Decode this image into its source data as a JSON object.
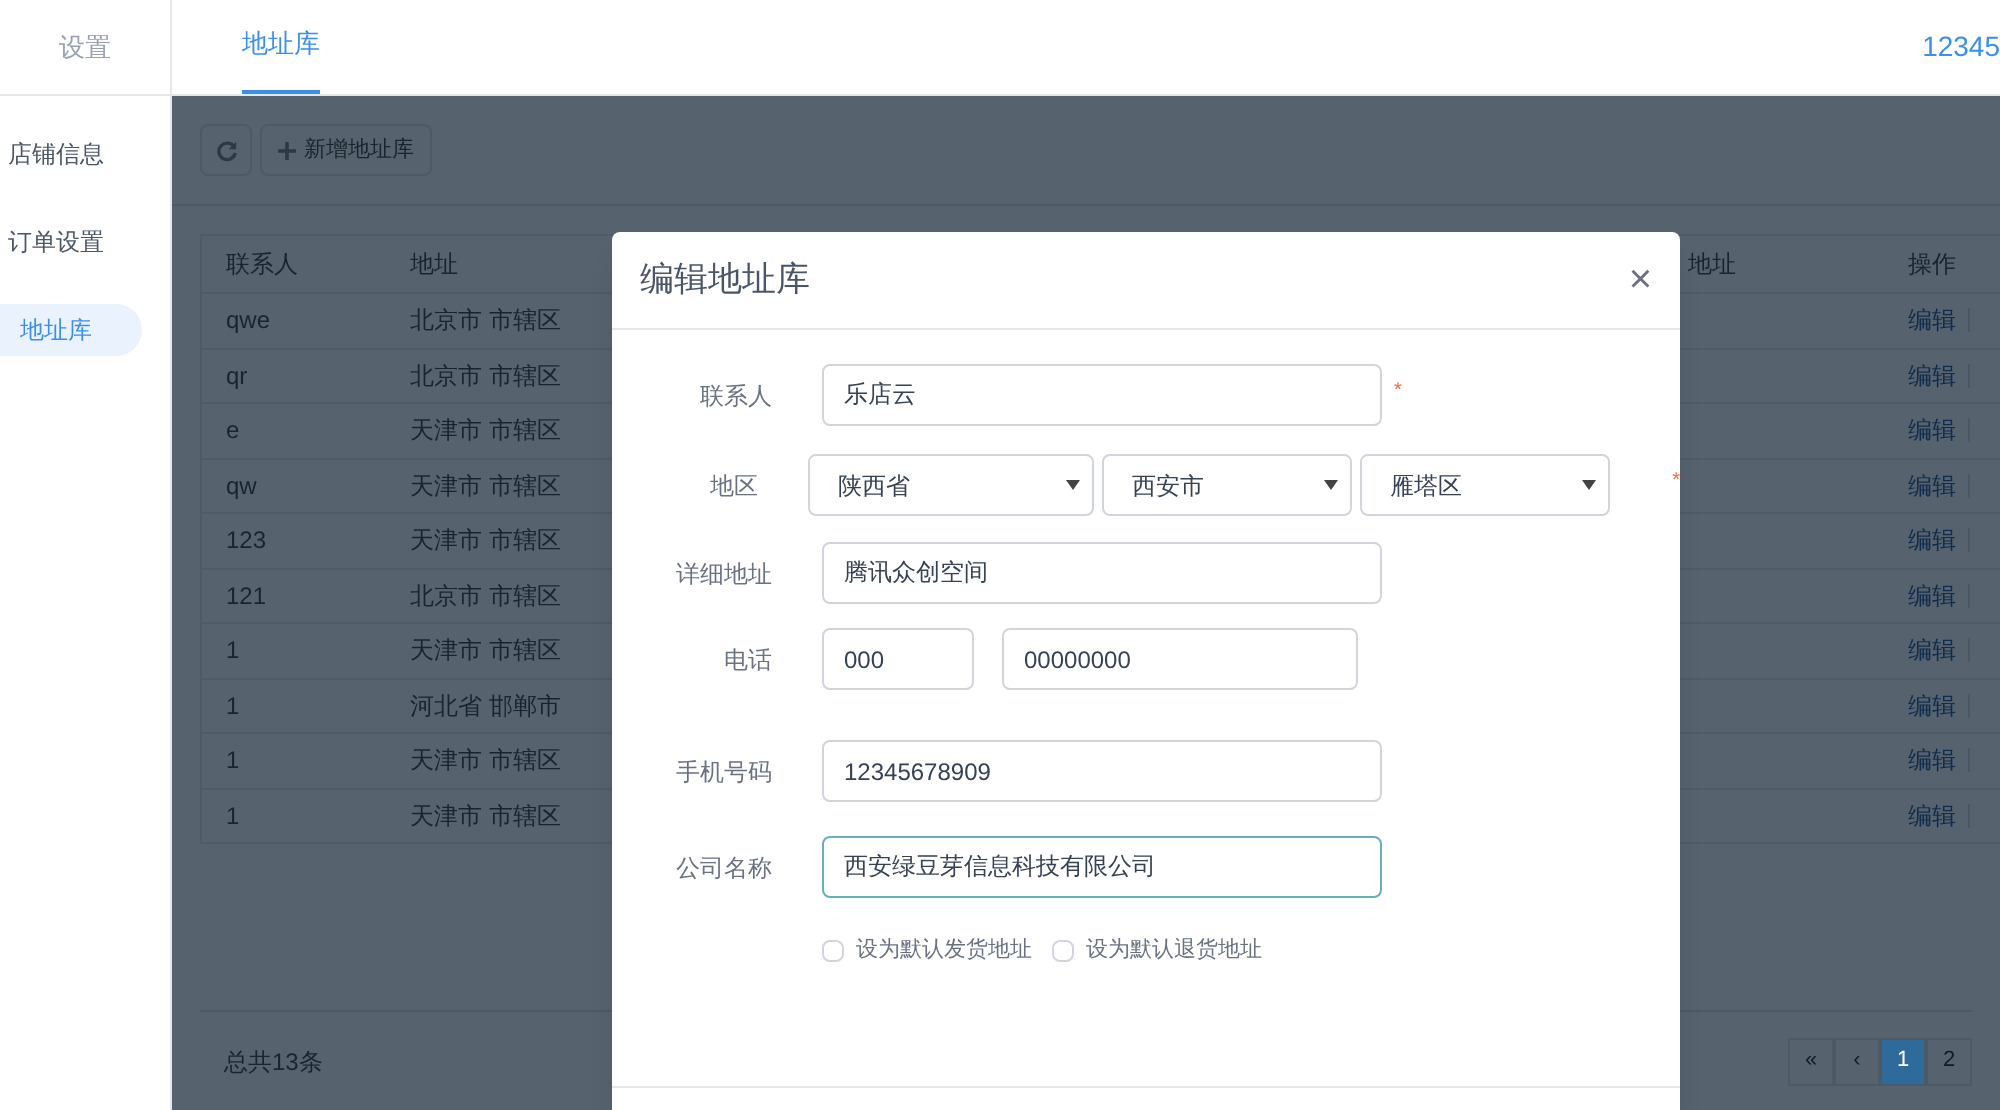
{
  "sidebar": {
    "title": "设置",
    "items": [
      {
        "label": "店铺信息",
        "selected": false
      },
      {
        "label": "订单设置",
        "selected": false
      },
      {
        "label": "地址库",
        "selected": true
      }
    ]
  },
  "tabs": [
    {
      "label": "地址库",
      "selected": true
    }
  ],
  "user": "12345",
  "toolbar": {
    "add_label": "新增地址库"
  },
  "table": {
    "columns": [
      "联系人",
      "地址",
      "地址",
      "操作"
    ],
    "rows": [
      {
        "contact": "qwe",
        "address": "北京市 市辖区",
        "action": "编辑"
      },
      {
        "contact": "qr",
        "address": "北京市 市辖区",
        "action": "编辑"
      },
      {
        "contact": "e",
        "address": "天津市 市辖区",
        "action": "编辑"
      },
      {
        "contact": "qw",
        "address": "天津市 市辖区",
        "action": "编辑"
      },
      {
        "contact": "123",
        "address": "天津市 市辖区",
        "action": "编辑"
      },
      {
        "contact": "121",
        "address": "北京市 市辖区",
        "action": "编辑"
      },
      {
        "contact": "1",
        "address": "天津市 市辖区",
        "action": "编辑"
      },
      {
        "contact": "1",
        "address": "河北省 邯郸市",
        "action": "编辑"
      },
      {
        "contact": "1",
        "address": "天津市 市辖区",
        "action": "编辑"
      },
      {
        "contact": "1",
        "address": "天津市 市辖区",
        "action": "编辑"
      }
    ]
  },
  "total": "总共13条",
  "pagination": [
    {
      "label": "«",
      "selected": false
    },
    {
      "label": "‹",
      "selected": false
    },
    {
      "label": "1",
      "selected": true
    },
    {
      "label": "2",
      "selected": false
    }
  ],
  "dialog": {
    "title": "编辑地址库",
    "close": "×",
    "required_mark": "*",
    "contact": {
      "label": "联系人",
      "value": "乐店云",
      "required": true
    },
    "region": {
      "label": "地区",
      "selects": [
        "陕西省",
        "西安市",
        "雁塔区"
      ],
      "required": true
    },
    "detail": {
      "label": "详细地址",
      "value": "腾讯众创空间"
    },
    "phone": {
      "label": "电话",
      "area": "000",
      "number": "00000000"
    },
    "mobile": {
      "label": "手机号码",
      "value": "12345678909"
    },
    "company": {
      "label": "公司名称",
      "value": "西安绿豆芽信息科技有限公司",
      "focused": true
    },
    "checkboxes": [
      {
        "label": "设为默认发货地址",
        "checked": false
      },
      {
        "label": "设为默认退货地址",
        "checked": false
      }
    ]
  }
}
